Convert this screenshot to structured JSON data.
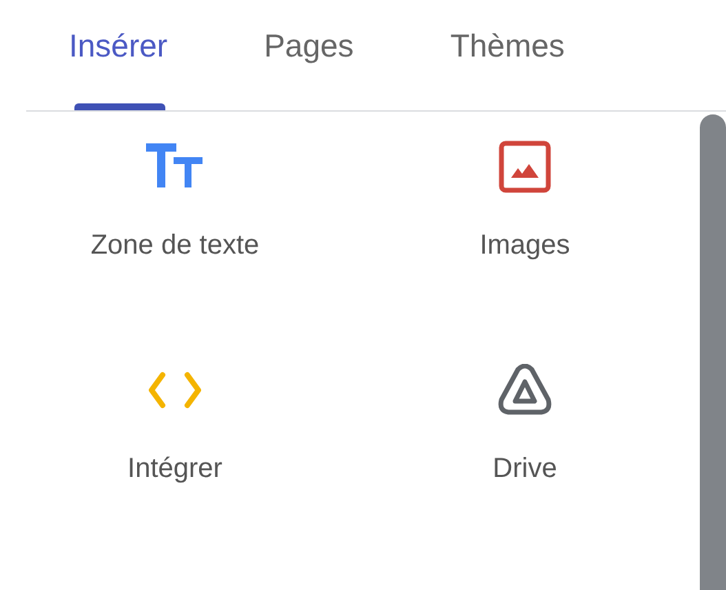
{
  "tabs": [
    {
      "label": "Insérer",
      "selected": true
    },
    {
      "label": "Pages",
      "selected": false
    },
    {
      "label": "Thèmes",
      "selected": false
    }
  ],
  "items": [
    {
      "kind": "text",
      "label": "Zone de texte"
    },
    {
      "kind": "image",
      "label": "Images"
    },
    {
      "kind": "embed",
      "label": "Intégrer"
    },
    {
      "kind": "drive",
      "label": "Drive"
    }
  ]
}
